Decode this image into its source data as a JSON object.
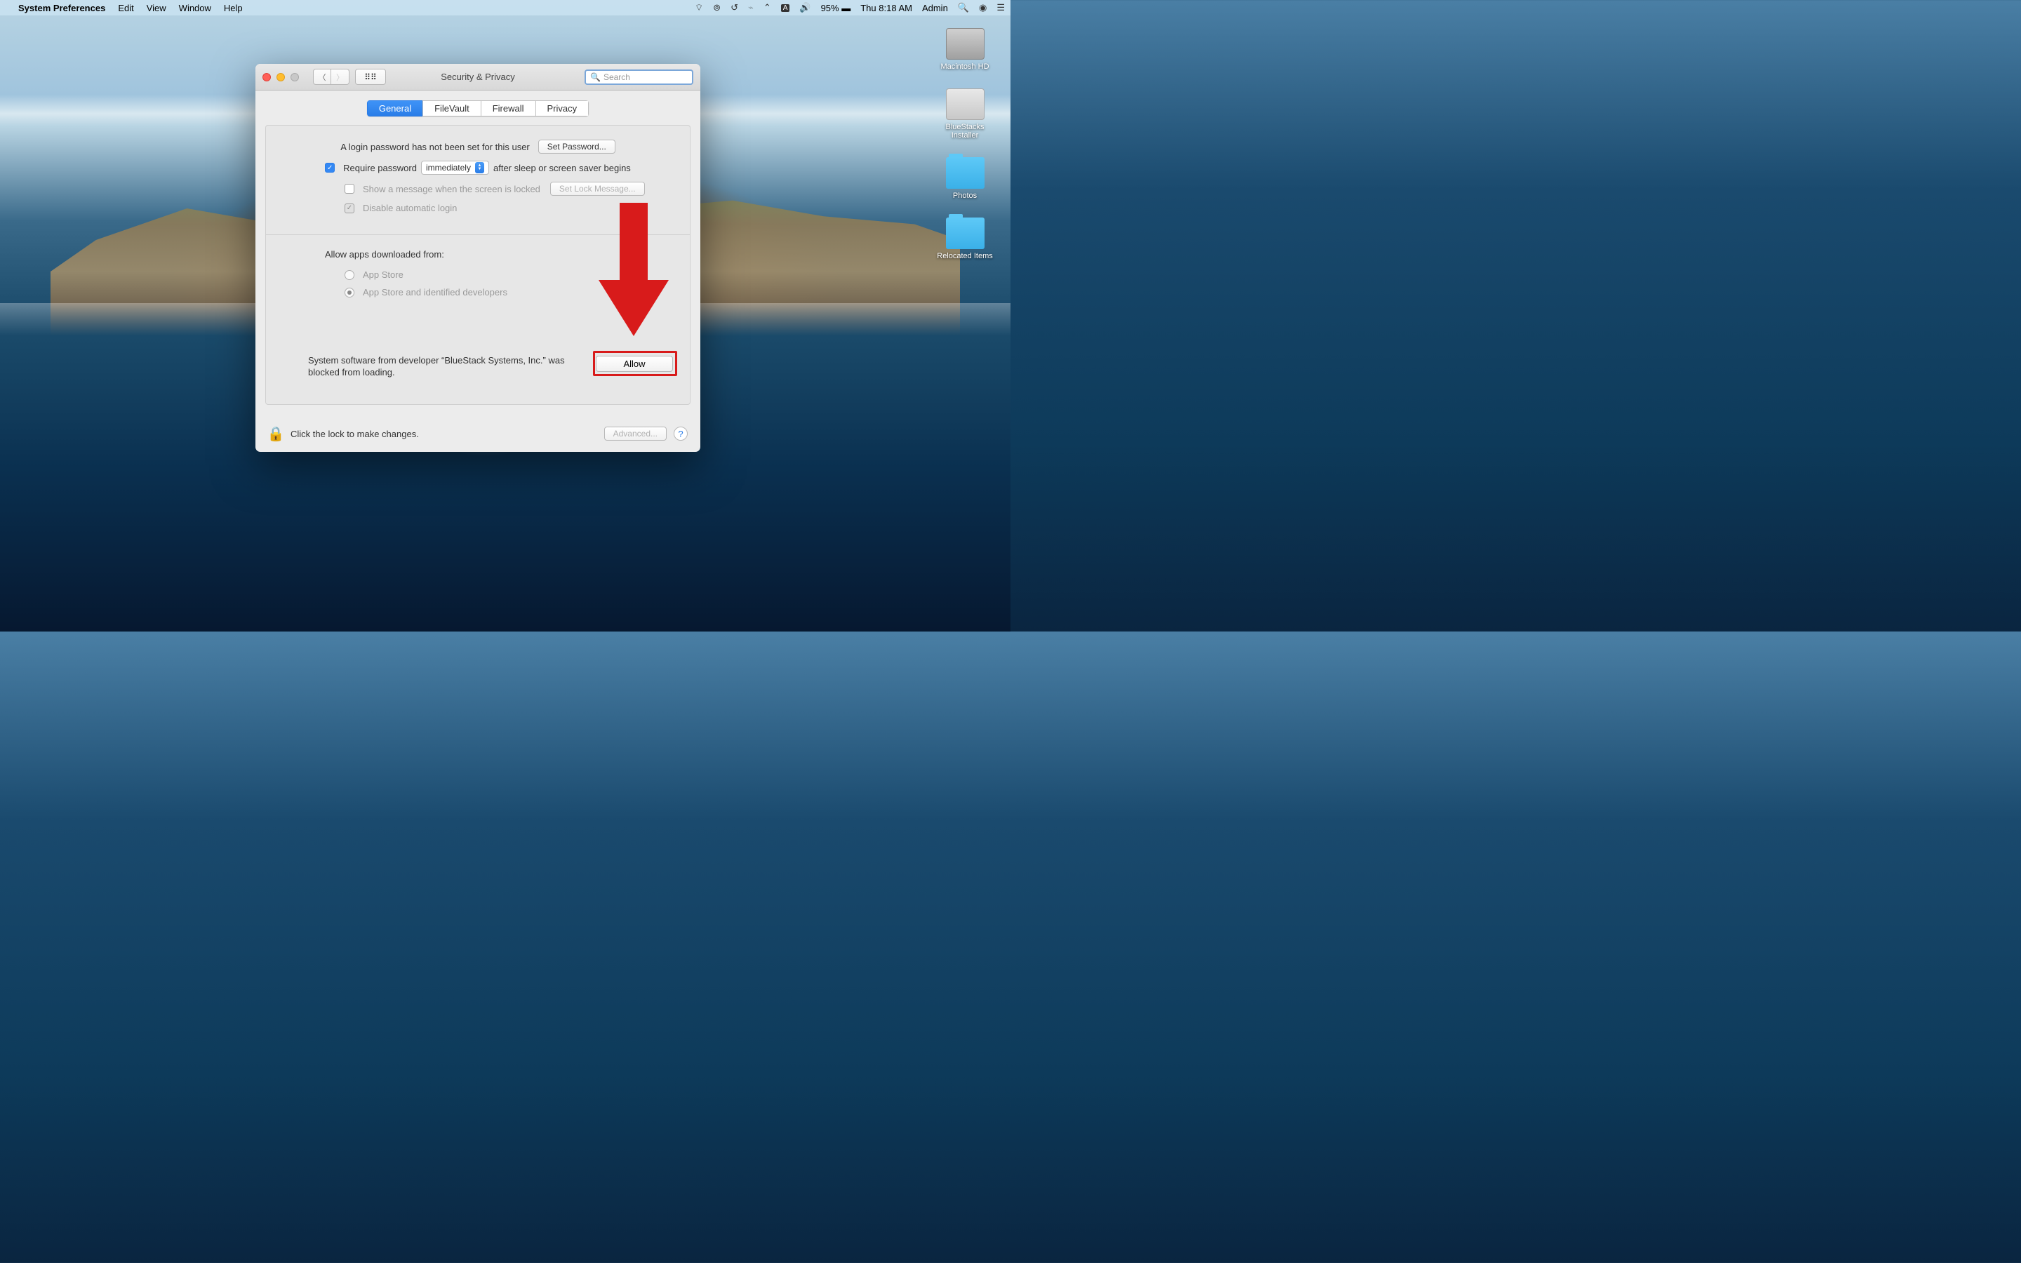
{
  "menubar": {
    "app": "System Preferences",
    "items": [
      "Edit",
      "View",
      "Window",
      "Help"
    ],
    "battery": "95%",
    "time": "Thu 8:18 AM",
    "user": "Admin"
  },
  "desktop": {
    "icons": [
      {
        "label": "Macintosh HD",
        "kind": "hd"
      },
      {
        "label": "BlueStacks Installer",
        "kind": "installer"
      },
      {
        "label": "Photos",
        "kind": "folder"
      },
      {
        "label": "Relocated Items",
        "kind": "folder"
      }
    ]
  },
  "window": {
    "title": "Security & Privacy",
    "search_placeholder": "Search",
    "tabs": [
      "General",
      "FileVault",
      "Firewall",
      "Privacy"
    ],
    "active_tab": "General",
    "login_pw_msg": "A login password has not been set for this user",
    "set_password_btn": "Set Password...",
    "require_pw_label_pre": "Require password",
    "require_pw_select": "immediately",
    "require_pw_label_post": "after sleep or screen saver begins",
    "show_msg_label": "Show a message when the screen is locked",
    "set_lock_msg_btn": "Set Lock Message...",
    "disable_auto_login": "Disable automatic login",
    "allow_apps_label": "Allow apps downloaded from:",
    "radio_app_store": "App Store",
    "radio_identified": "App Store and identified developers",
    "blocked_msg": "System software from developer “BlueStack Systems, Inc.” was blocked from loading.",
    "allow_btn": "Allow",
    "lock_msg": "Click the lock to make changes.",
    "advanced_btn": "Advanced..."
  }
}
